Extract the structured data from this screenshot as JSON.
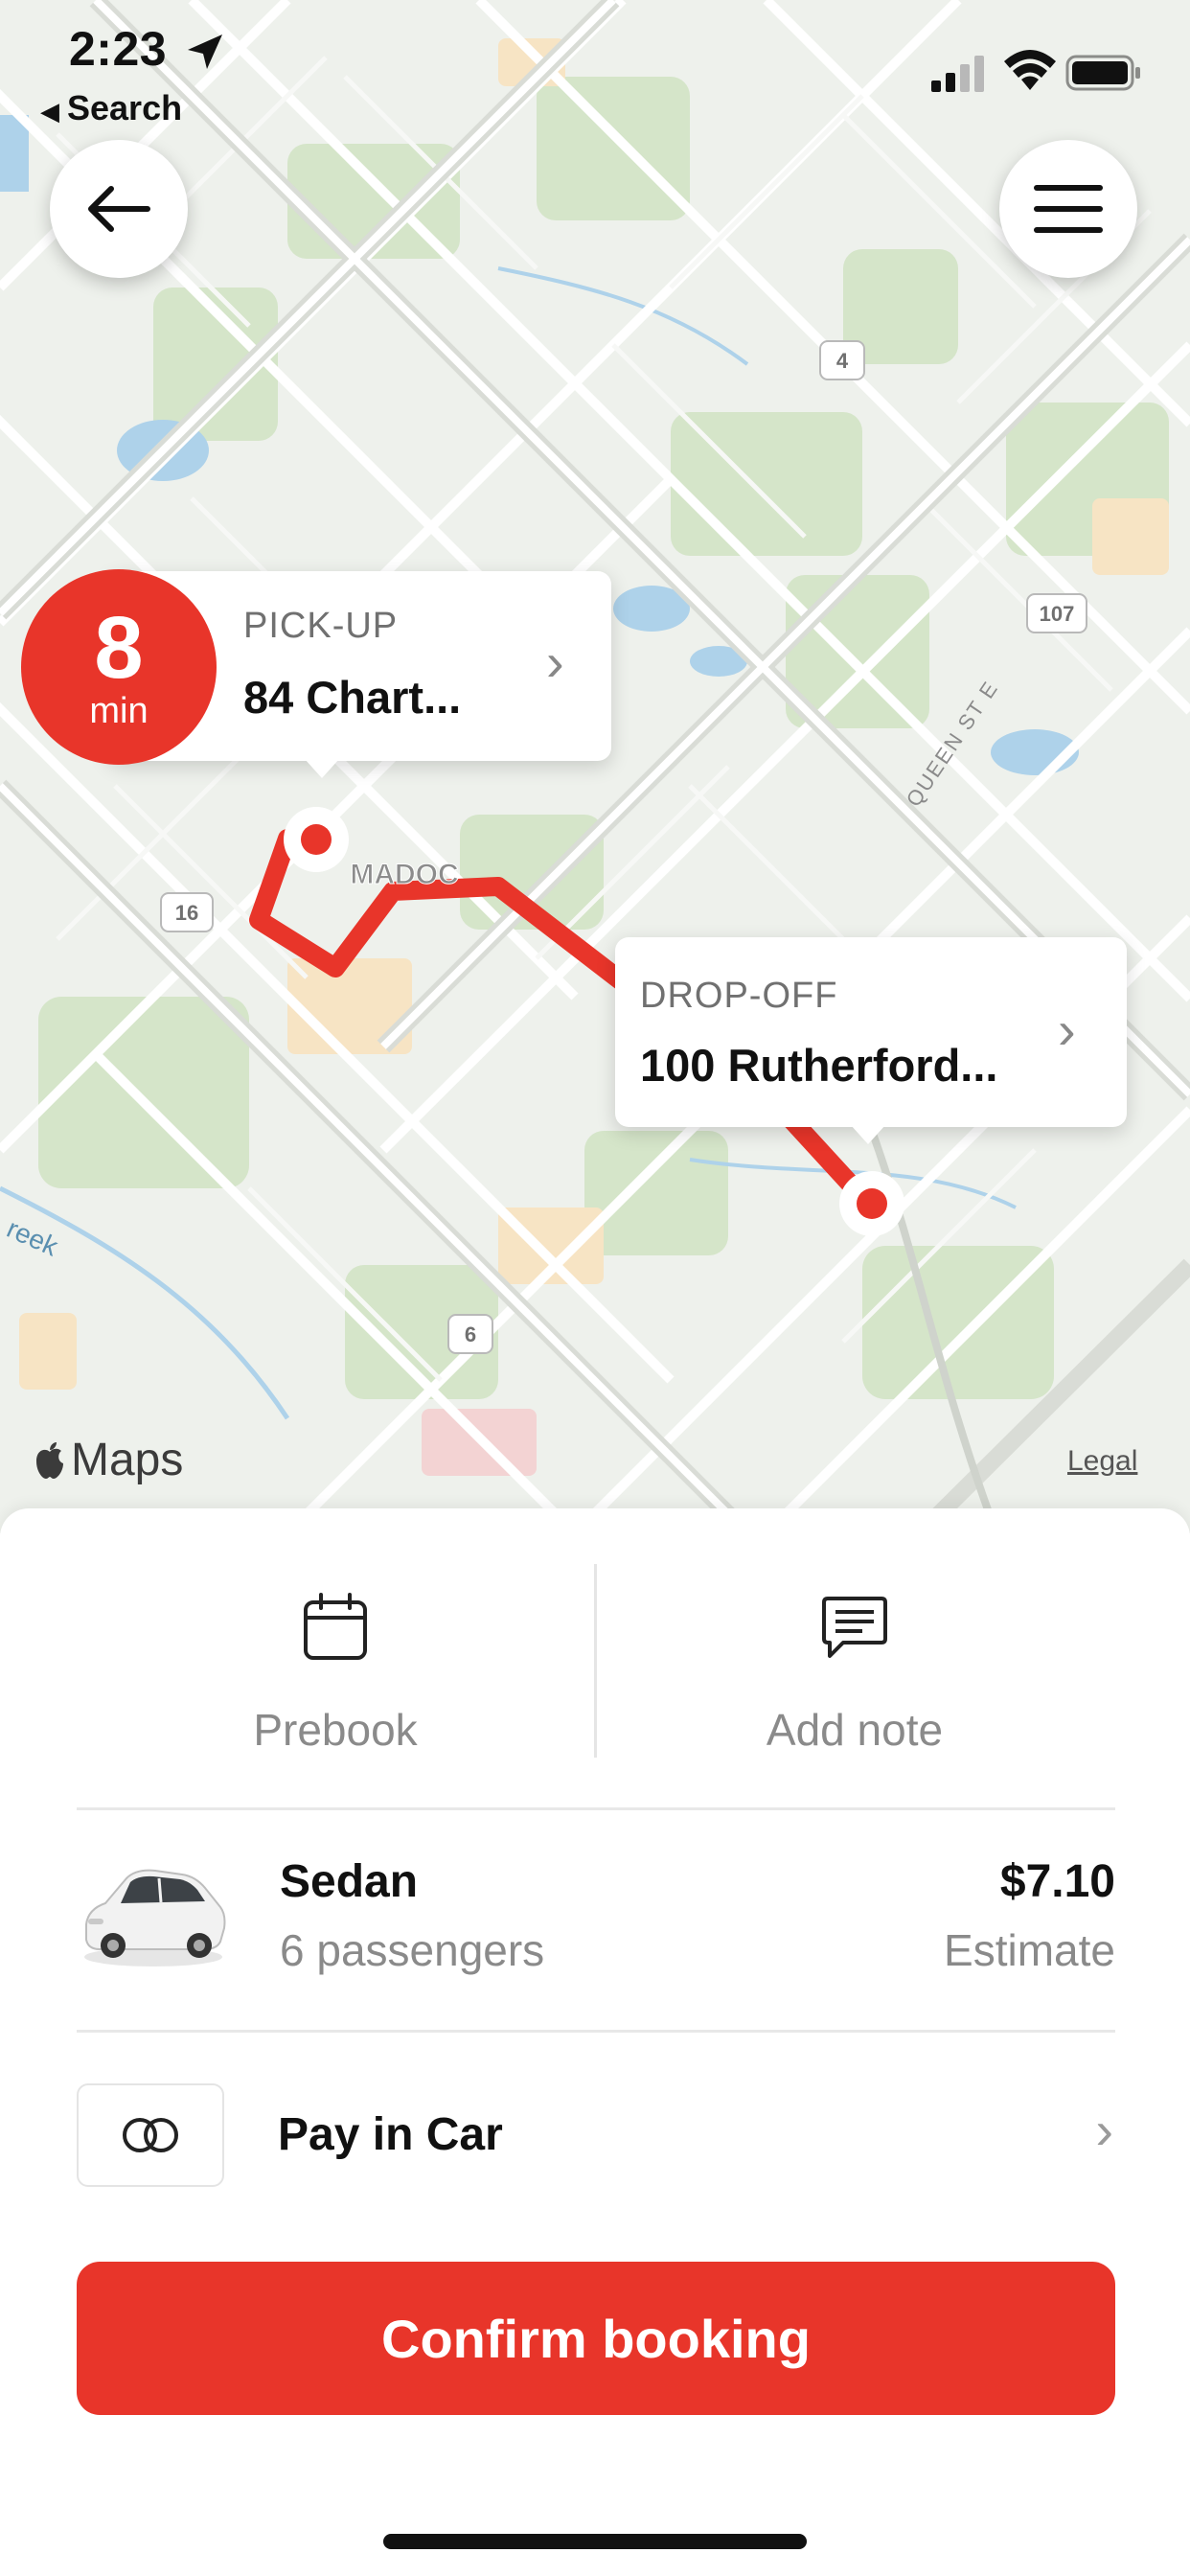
{
  "status_bar": {
    "time": "2:23",
    "back_app_label": "Search"
  },
  "map": {
    "route_color": "#e8352a",
    "labels": {
      "road_4": "4",
      "road_107": "107",
      "road_16": "16",
      "road_6": "6",
      "street_queen": "QUEEN ST E",
      "area_madoc": "MADOC",
      "creek": "reek"
    },
    "maps_logo_text": "Maps",
    "legal_link": "Legal"
  },
  "top_buttons": {
    "back_icon": "arrow-left-icon",
    "menu_icon": "hamburger-menu-icon"
  },
  "eta": {
    "value": "8",
    "unit": "min"
  },
  "pickup": {
    "label": "PICK-UP",
    "address": "84 Chart..."
  },
  "dropoff": {
    "label": "DROP-OFF",
    "address": "100 Rutherford..."
  },
  "actions": {
    "prebook": {
      "label": "Prebook",
      "icon": "calendar-icon"
    },
    "note": {
      "label": "Add note",
      "icon": "message-icon"
    }
  },
  "vehicle": {
    "name": "Sedan",
    "capacity": "6 passengers",
    "price": "$7.10",
    "price_note": "Estimate"
  },
  "payment": {
    "label": "Pay in Car",
    "icon": "cash-card-icon"
  },
  "confirm_button": {
    "label": "Confirm booking"
  },
  "colors": {
    "accent": "#e8352a",
    "map_background": "#eef1ec",
    "park_green": "#d5e5c9",
    "water": "#aed2ea"
  }
}
